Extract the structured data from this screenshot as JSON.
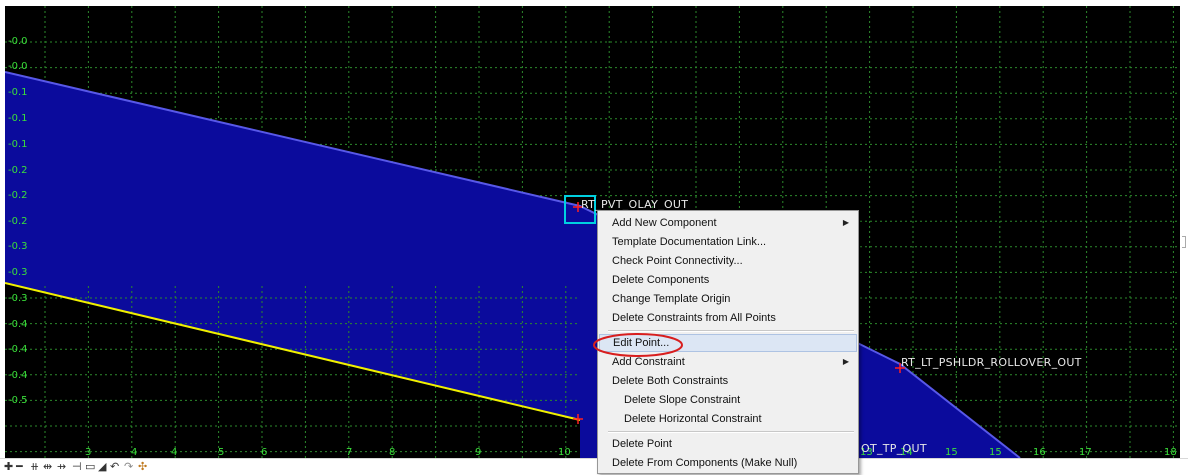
{
  "canvas": {
    "y_ticks": [
      "-0.0",
      "-0.0",
      "-0.1",
      "-0.1",
      "-0.1",
      "-0.2",
      "-0.2",
      "-0.2",
      "-0.3",
      "-0.3",
      "-0.3",
      "-0.4",
      "-0.4",
      "-0.4",
      "-0.5"
    ],
    "x_ticks": [
      "3",
      "4",
      "4",
      "5",
      "6",
      "7",
      "8",
      "9",
      "10",
      "13",
      "14",
      "15",
      "15",
      "16",
      "17",
      "18"
    ],
    "point_labels": {
      "rt_pvt_olay_out": "RT_PVT_OLAY_OUT",
      "rt_lt_pshldr_rollover_out": "RT_LT_PSHLDR_ROLLOVER_OUT",
      "partial_label": "OT_TP_OUT"
    },
    "colors": {
      "component_fill": "#0b0b9c",
      "component_edge": "#5858e8",
      "yellow_line": "#f0f000",
      "grid": "#2c8a2c",
      "point_marker": "#ff2020",
      "selection_box": "#00d0e0"
    }
  },
  "context_menu": {
    "items": [
      {
        "label": "Add New Component",
        "submenu": true
      },
      {
        "label": "Template Documentation Link..."
      },
      {
        "label": "Check Point Connectivity..."
      },
      {
        "label": "Delete Components"
      },
      {
        "label": "Change Template Origin"
      },
      {
        "label": "Delete Constraints from All Points"
      },
      {
        "label": "Edit Point...",
        "highlighted": true
      },
      {
        "label": "Add Constraint",
        "submenu": true
      },
      {
        "label": "Delete Both Constraints"
      },
      {
        "label": "Delete Slope Constraint"
      },
      {
        "label": "Delete Horizontal Constraint"
      },
      {
        "label": "Delete Point"
      },
      {
        "label": "Delete From Components (Make Null)"
      }
    ],
    "submenu_arrow": "▶"
  },
  "toolbar": {
    "icons": [
      "add-icon",
      "subtract-icon",
      "pan-icon",
      "zoom-in-icon",
      "zoom-out-icon",
      "fit-icon",
      "window-icon",
      "undo-icon",
      "redo-icon",
      "measure-icon",
      "scroll-left-icon"
    ],
    "glyphs": [
      "✚",
      "━",
      "⧺",
      "⇹",
      "⇸",
      "⊣",
      "▭",
      "◢",
      "↶",
      "↷",
      "✣"
    ]
  }
}
